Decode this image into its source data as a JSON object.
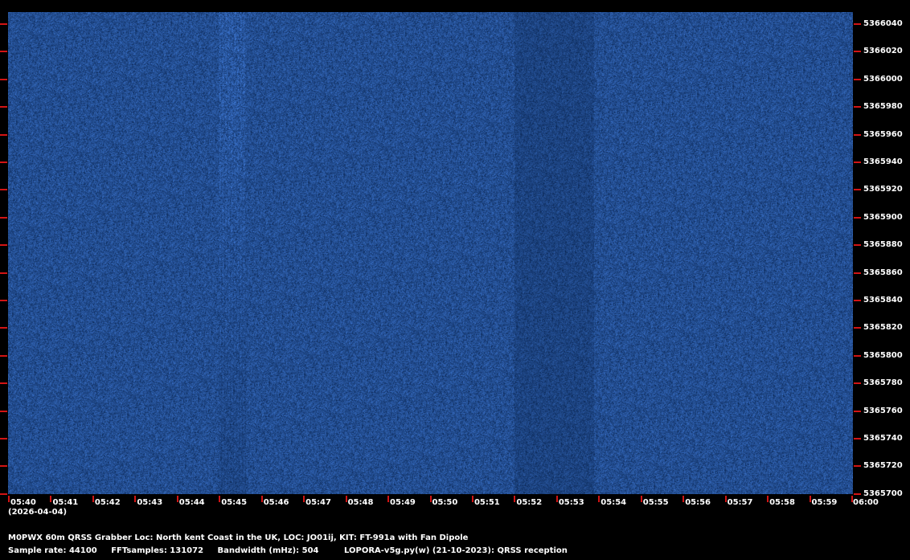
{
  "spectrogram": {
    "background_color": "#143c7a",
    "tick_color": "#d21414",
    "frequency_labels": [
      "5366040",
      "5366020",
      "5366000",
      "5365980",
      "5365960",
      "5365940",
      "5365920",
      "5365900",
      "5365880",
      "5365860",
      "5365840",
      "5365820",
      "5365800",
      "5365780",
      "5365760",
      "5365740",
      "5365720",
      "5365700"
    ],
    "time_labels": [
      "05:40",
      "05:41",
      "05:42",
      "05:43",
      "05:44",
      "05:45",
      "05:46",
      "05:47",
      "05:48",
      "05:49",
      "05:50",
      "05:51",
      "05:52",
      "05:53",
      "05:54",
      "05:55",
      "05:56",
      "05:57",
      "05:58",
      "05:59",
      "06:00"
    ],
    "date": "(2026-04-04)"
  },
  "footer": {
    "line1": "M0PWX 60m QRSS Grabber Loc: North kent Coast in the UK, LOC: JO01ij, KIT: FT-991a with Fan Dipole",
    "sample_rate": "Sample rate: 44100",
    "fft_samples": "FFTsamples: 131072",
    "bandwidth": "Bandwidth (mHz): 504",
    "software": "LOPORA-v5g.py(w) (21-10-2023): QRSS reception"
  }
}
